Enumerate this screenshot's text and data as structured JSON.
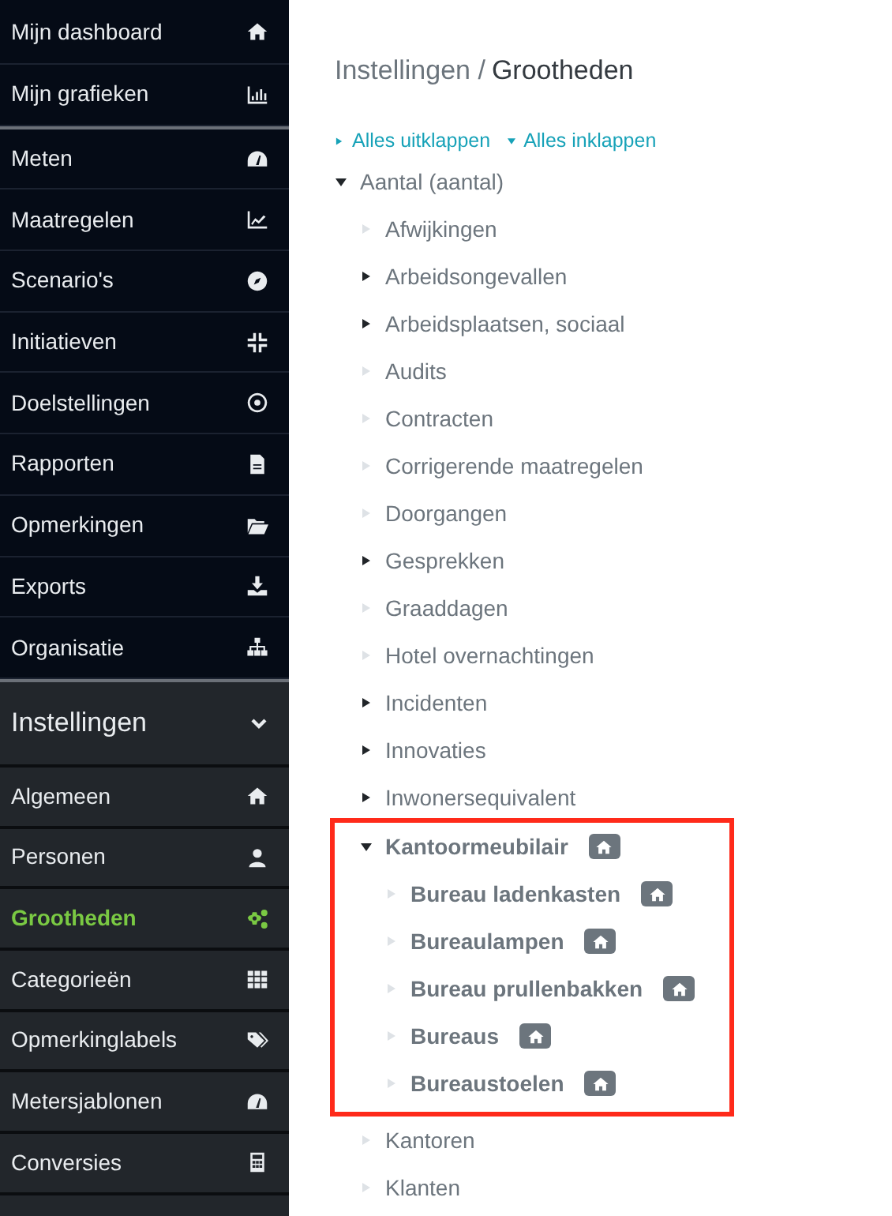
{
  "sidebar": {
    "sections": [
      {
        "items": [
          {
            "label": "Mijn dashboard",
            "selected": false
          },
          {
            "label": "Mijn grafieken",
            "selected": false
          }
        ]
      },
      {
        "items": [
          {
            "label": "Meten",
            "selected": false
          },
          {
            "label": "Maatregelen",
            "selected": false
          },
          {
            "label": "Scenario's",
            "selected": false
          },
          {
            "label": "Initiatieven",
            "selected": false
          },
          {
            "label": "Doelstellingen",
            "selected": false
          },
          {
            "label": "Rapporten",
            "selected": false
          },
          {
            "label": "Opmerkingen",
            "selected": false
          },
          {
            "label": "Exports",
            "selected": false
          },
          {
            "label": "Organisatie",
            "selected": false
          }
        ]
      }
    ],
    "settings": {
      "title": "Instellingen",
      "expanded": true,
      "items": [
        {
          "label": "Algemeen",
          "selected": false
        },
        {
          "label": "Personen",
          "selected": false
        },
        {
          "label": "Grootheden",
          "selected": true
        },
        {
          "label": "Categorieën",
          "selected": false
        },
        {
          "label": "Opmerkinglabels",
          "selected": false
        },
        {
          "label": "Metersjablonen",
          "selected": false
        },
        {
          "label": "Conversies",
          "selected": false
        }
      ]
    }
  },
  "breadcrumb": [
    {
      "label": "Instellingen /",
      "current": false
    },
    {
      "label": "Grootheden",
      "current": true
    }
  ],
  "tree_actions": [
    {
      "label": "Alles uitklappen",
      "kind": "expand"
    },
    {
      "label": "Alles inklappen",
      "kind": "collapse"
    }
  ],
  "tree": [
    {
      "label": "Aantal (aantal)",
      "kind": "branch",
      "expanded": true,
      "bold": false,
      "badge": false,
      "highlighted": false,
      "children": [
        {
          "label": "Afwijkingen",
          "kind": "leaf",
          "bold": false,
          "badge": false,
          "highlighted": false
        },
        {
          "label": "Arbeidsongevallen",
          "kind": "branch",
          "expanded": false,
          "bold": false,
          "badge": false,
          "highlighted": false
        },
        {
          "label": "Arbeidsplaatsen, sociaal",
          "kind": "branch",
          "expanded": false,
          "bold": false,
          "badge": false,
          "highlighted": false
        },
        {
          "label": "Audits",
          "kind": "leaf",
          "bold": false,
          "badge": false,
          "highlighted": false
        },
        {
          "label": "Contracten",
          "kind": "leaf",
          "bold": false,
          "badge": false,
          "highlighted": false
        },
        {
          "label": "Corrigerende maatregelen",
          "kind": "leaf",
          "bold": false,
          "badge": false,
          "highlighted": false
        },
        {
          "label": "Doorgangen",
          "kind": "leaf",
          "bold": false,
          "badge": false,
          "highlighted": false
        },
        {
          "label": "Gesprekken",
          "kind": "branch",
          "expanded": false,
          "bold": false,
          "badge": false,
          "highlighted": false
        },
        {
          "label": "Graaddagen",
          "kind": "leaf",
          "bold": false,
          "badge": false,
          "highlighted": false
        },
        {
          "label": "Hotel overnachtingen",
          "kind": "leaf",
          "bold": false,
          "badge": false,
          "highlighted": false
        },
        {
          "label": "Incidenten",
          "kind": "branch",
          "expanded": false,
          "bold": false,
          "badge": false,
          "highlighted": false
        },
        {
          "label": "Innovaties",
          "kind": "branch",
          "expanded": false,
          "bold": false,
          "badge": false,
          "highlighted": false
        },
        {
          "label": "Inwonersequivalent",
          "kind": "branch",
          "expanded": false,
          "bold": false,
          "badge": false,
          "highlighted": false
        },
        {
          "label": "Kantoormeubilair",
          "kind": "branch",
          "expanded": true,
          "bold": true,
          "badge": true,
          "highlighted": true,
          "children": [
            {
              "label": "Bureau ladenkasten",
              "kind": "leaf",
              "bold": true,
              "badge": true,
              "highlighted": false
            },
            {
              "label": "Bureaulampen",
              "kind": "leaf",
              "bold": true,
              "badge": true,
              "highlighted": false
            },
            {
              "label": "Bureau prullenbakken",
              "kind": "leaf",
              "bold": true,
              "badge": true,
              "highlighted": false
            },
            {
              "label": "Bureaus",
              "kind": "leaf",
              "bold": true,
              "badge": true,
              "highlighted": false
            },
            {
              "label": "Bureaustoelen",
              "kind": "leaf",
              "bold": true,
              "badge": true,
              "highlighted": false
            }
          ]
        },
        {
          "label": "Kantoren",
          "kind": "leaf",
          "bold": false,
          "badge": false,
          "highlighted": false
        },
        {
          "label": "Klanten",
          "kind": "leaf",
          "bold": false,
          "badge": false,
          "highlighted": false
        }
      ]
    }
  ]
}
